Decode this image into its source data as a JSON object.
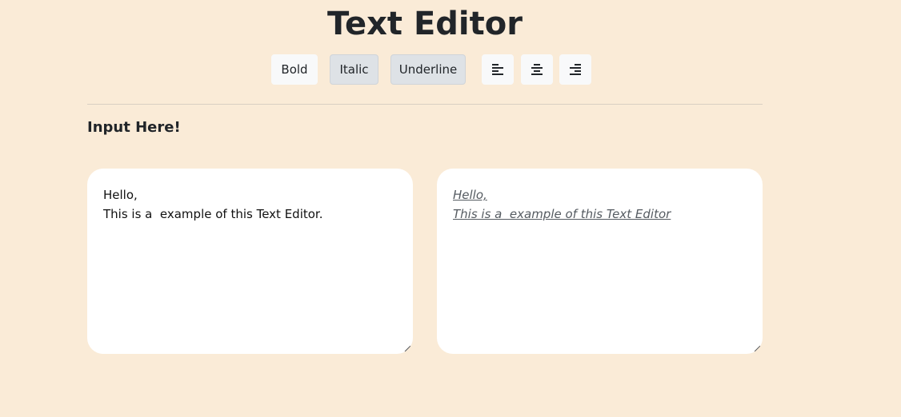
{
  "header": {
    "title": "Text Editor"
  },
  "toolbar": {
    "bold_label": "Bold",
    "italic_label": "Italic",
    "underline_label": "Underline",
    "italic_active": true,
    "underline_active": true,
    "align_left_icon": "align-left-icon",
    "align_center_icon": "align-center-icon",
    "align_right_icon": "align-right-icon"
  },
  "main": {
    "section_label": "Input Here!",
    "input_text": "Hello,\nThis is a  example of this Text Editor.",
    "output_text": "Hello,\nThis is a  example of this Text Editor"
  },
  "colors": {
    "background": "#faebd7",
    "panel": "#ffffff",
    "active_button": "#dee2e6",
    "plain_button": "#f8f9fa"
  }
}
